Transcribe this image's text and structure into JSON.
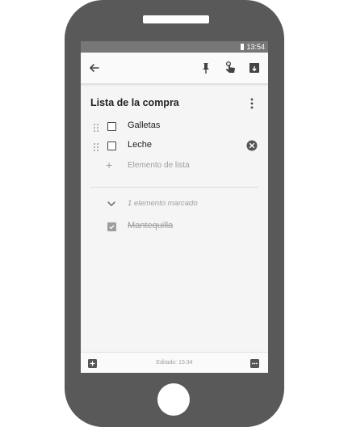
{
  "statusbar": {
    "time": "13:54"
  },
  "note": {
    "title": "Lista de la compra",
    "items": [
      {
        "label": "Galletas",
        "checked": false
      },
      {
        "label": "Leche",
        "checked": false
      }
    ],
    "add_placeholder": "Elemento de lista",
    "checked_summary": "1 elemento marcado",
    "checked_items": [
      {
        "label": "Mantequilla",
        "checked": true
      }
    ]
  },
  "footer": {
    "edited": "Editado: 15:34"
  },
  "icons": {
    "back": "arrow-left-icon",
    "pin": "pin-icon",
    "reminder": "hand-reminder-icon",
    "archive": "archive-icon",
    "more": "more-vert-icon",
    "clear": "close-circle-icon",
    "drag": "drag-handle-icon",
    "add": "add-box-icon",
    "more_box": "more-horiz-icon"
  }
}
